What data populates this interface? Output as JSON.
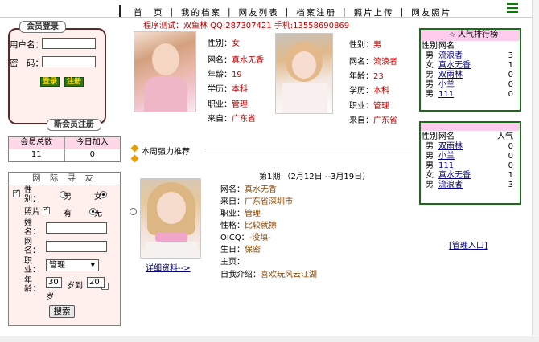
{
  "nav": {
    "items": [
      "首　页",
      "我的档案",
      "网友列表",
      "档案注册",
      "照片上传",
      "网友照片"
    ]
  },
  "contact": "程序测试：双鱼林 QQ:287307421 手机:13558690869",
  "login": {
    "title": "会员登录",
    "username_label": "用户名：",
    "password_label": "密　码：",
    "login_button": "登录",
    "register_button": "注册",
    "new_member_label": "新会员注册"
  },
  "stats": {
    "headers": [
      "会员总数",
      "今日加入"
    ],
    "values": [
      "11",
      "0"
    ]
  },
  "search": {
    "title": "网 际 寻 友",
    "gender_label": "性别：",
    "gender_male": "男",
    "gender_female": "女",
    "photo_label": "照片",
    "photo_yes": "有",
    "photo_no": "无",
    "name_label": "姓名：",
    "nick_label": "网名：",
    "job_label": "职业：",
    "job_value": "管理",
    "age_label": "年龄：",
    "age_from": "30",
    "age_to_label": "岁到",
    "age_to": "20",
    "age_unit": "岁",
    "search_button": "搜索"
  },
  "profiles": [
    {
      "gender_label": "性别：",
      "gender": "女",
      "nick_label": "网名：",
      "nick": "真水无香",
      "age_label": "年龄：",
      "age": "19",
      "edu_label": "学历：",
      "edu": "本科",
      "job_label": "职业：",
      "job": "管理",
      "from_label": "来自：",
      "from": "广东省"
    },
    {
      "gender_label": "性别：",
      "gender": "男",
      "nick_label": "网名：",
      "nick": "流浪者",
      "age_label": "年龄：",
      "age": "23",
      "edu_label": "学历：",
      "edu": "本科",
      "job_label": "职业：",
      "job": "管理",
      "from_label": "来自：",
      "from": "广东省"
    }
  ],
  "rank1": {
    "title": "人气排行榜",
    "col_gender": "性别",
    "col_name": "网名",
    "rows": [
      {
        "g": "男",
        "n": "流浪者",
        "c": "3"
      },
      {
        "g": "女",
        "n": "真水无香",
        "c": "1"
      },
      {
        "g": "男",
        "n": "双雨林",
        "c": "0"
      },
      {
        "g": "男",
        "n": "小兰",
        "c": "0"
      },
      {
        "g": "男",
        "n": "111",
        "c": "0"
      }
    ]
  },
  "rank2": {
    "col_gender": "性别",
    "col_name": "网名",
    "col_pop": "人气",
    "rows": [
      {
        "g": "男",
        "n": "双雨林",
        "c": "0"
      },
      {
        "g": "男",
        "n": "小兰",
        "c": "0"
      },
      {
        "g": "男",
        "n": "111",
        "c": "0"
      },
      {
        "g": "女",
        "n": "真水无香",
        "c": "1"
      },
      {
        "g": "男",
        "n": "流浪者",
        "c": "3"
      }
    ]
  },
  "weekly": {
    "title": "本周强力推荐",
    "period": "第1期 （2月12日 --3月19日）",
    "nick_label": "网名：",
    "nick": "真水无香",
    "from_label": "来自：",
    "from": "广东省深圳市",
    "job_label": "职业：",
    "job": "管理",
    "char_label": "性格：",
    "char": "比较就擦",
    "oicq_label": "OICQ：",
    "oicq": "-没填-",
    "birth_label": "生日：",
    "birth": "保密",
    "home_label": "主页：",
    "home": "",
    "intro_label": "自我介绍：",
    "intro": "喜欢玩风云江湖",
    "details_link": "详细资料-->"
  },
  "admin_link": "[管理入口]",
  "colors": {
    "accent_red": "#c00000",
    "rank_border": "#1a6a1a",
    "pink": "#ffccee",
    "login_bg": "#fff0ee"
  }
}
